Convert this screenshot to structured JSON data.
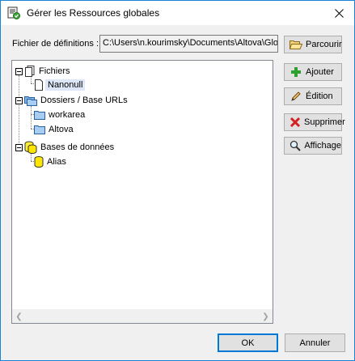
{
  "window": {
    "title": "Gérer les Ressources globales",
    "icon": "global-resources-icon"
  },
  "definitions": {
    "label": "Fichier de définitions :",
    "path_value": "C:\\Users\\n.kourimsky\\Documents\\Altova\\GlobalResources.xml"
  },
  "tree": {
    "groups": [
      {
        "label": "Fichiers",
        "icon": "files-icon",
        "children": [
          {
            "label": "Nanonull",
            "icon": "file-icon",
            "selected": true
          }
        ]
      },
      {
        "label": "Dossiers / Base URLs",
        "icon": "folders-icon",
        "children": [
          {
            "label": "workarea",
            "icon": "folder-icon"
          },
          {
            "label": "Altova",
            "icon": "folder-icon"
          }
        ]
      },
      {
        "label": "Bases de données",
        "icon": "databases-icon",
        "children": [
          {
            "label": "Alias",
            "icon": "database-icon"
          }
        ]
      }
    ]
  },
  "buttons": {
    "browse": "Parcourir",
    "add": "Ajouter",
    "edit": "Édition",
    "delete": "Supprimer",
    "view": "Affichage",
    "ok": "OK",
    "cancel": "Annuler"
  }
}
